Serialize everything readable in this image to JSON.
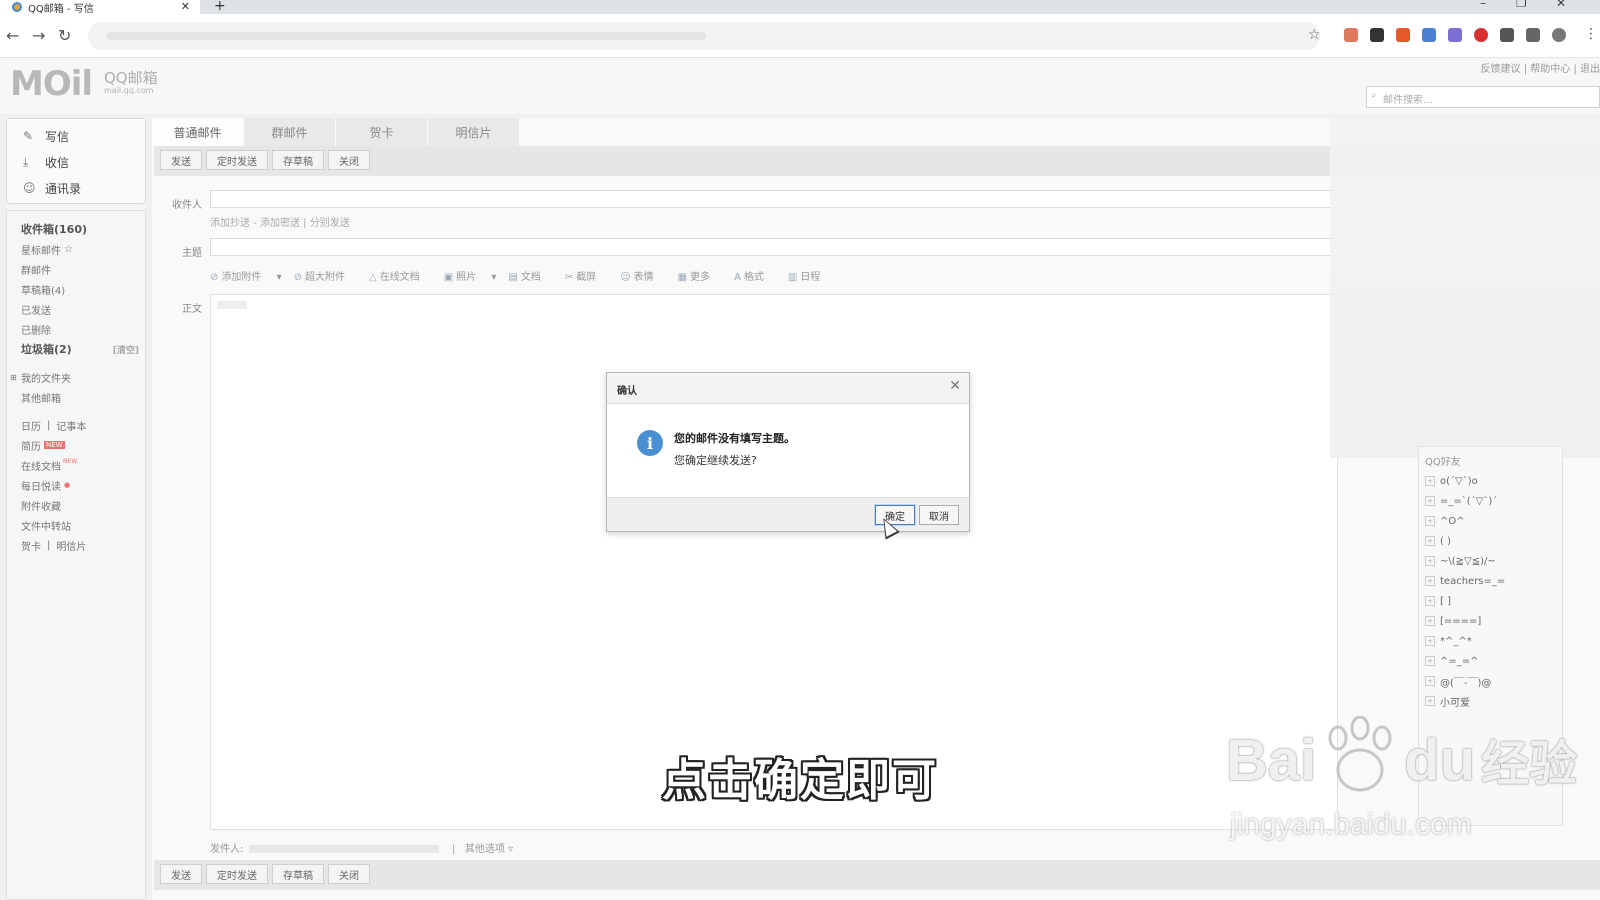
{
  "browser": {
    "tab_title": "QQ邮箱 - 写信",
    "tab_close": "✕",
    "new_tab": "+",
    "back": "←",
    "forward": "→",
    "reload": "↻",
    "star": "☆",
    "menu": "⋮",
    "win_min": "–",
    "win_max": "❐",
    "win_close": "✕"
  },
  "header": {
    "logo": "MOil",
    "logo_sub": "QQ邮箱",
    "logo_url": "mail.qq.com",
    "top_links": "反馈建议 | 帮助中心 | 退出",
    "search_placeholder": "邮件搜索..."
  },
  "sidebar": {
    "actions": [
      {
        "label": "写信",
        "icon": "pen-icon"
      },
      {
        "label": "收信",
        "icon": "download-icon"
      },
      {
        "label": "通讯录",
        "icon": "contacts-icon"
      }
    ],
    "inbox": "收件箱(160)",
    "starred": "星标邮件",
    "group": "群邮件",
    "drafts": "草稿箱(4)",
    "sent": "已发送",
    "deleted": "已删除",
    "junk": "垃圾箱(2)",
    "junk_clear": "[清空]",
    "my_folders": "我的文件夹",
    "other_mail": "其他邮箱",
    "calendar": "日历",
    "notebook": "记事本",
    "resume": "简历",
    "resume_badge": "NEW",
    "online_docs": "在线文档",
    "online_docs_badge": "NEW",
    "daily_read": "每日悦读",
    "attachments": "附件收藏",
    "file_transfer": "文件中转站",
    "card": "贺卡",
    "postcard": "明信片"
  },
  "compose": {
    "tabs": [
      "普通邮件",
      "群邮件",
      "贺卡",
      "明信片"
    ],
    "buttons": [
      "发送",
      "定时发送",
      "存草稿",
      "关闭"
    ],
    "to_label": "收件人",
    "cc_links": "添加抄送 - 添加密送 | 分别发送",
    "subject_label": "主题",
    "body_label": "正文",
    "editor_tools": [
      "添加附件",
      "超大附件",
      "在线文档",
      "照片",
      "文档",
      "截屏",
      "表情",
      "更多",
      "格式",
      "日程"
    ],
    "sender_label": "发件人:",
    "other_options": "其他选项"
  },
  "friends": {
    "header": "QQ好友",
    "groups": [
      "o(ˊ▽ˋ)o",
      "=_=ˋ(ˊ▽ˋ)ˊ",
      "^O^",
      "( )",
      "~\\(≧▽≦)/~",
      "teachers=_=",
      "[ ]",
      "[====]",
      "*^_^*",
      "^=_=^",
      "@(￣-￣)@",
      "小可爱"
    ]
  },
  "dialog": {
    "title": "确认",
    "close": "✕",
    "message": "您的邮件没有填写主题。",
    "question": "您确定继续发送?",
    "ok": "确定",
    "cancel": "取消"
  },
  "caption": "点击确定即可",
  "watermark": {
    "brand_a": "Bai",
    "brand_b": "du",
    "brand_cn": "经验",
    "url": "jingyan.baidu.com"
  }
}
